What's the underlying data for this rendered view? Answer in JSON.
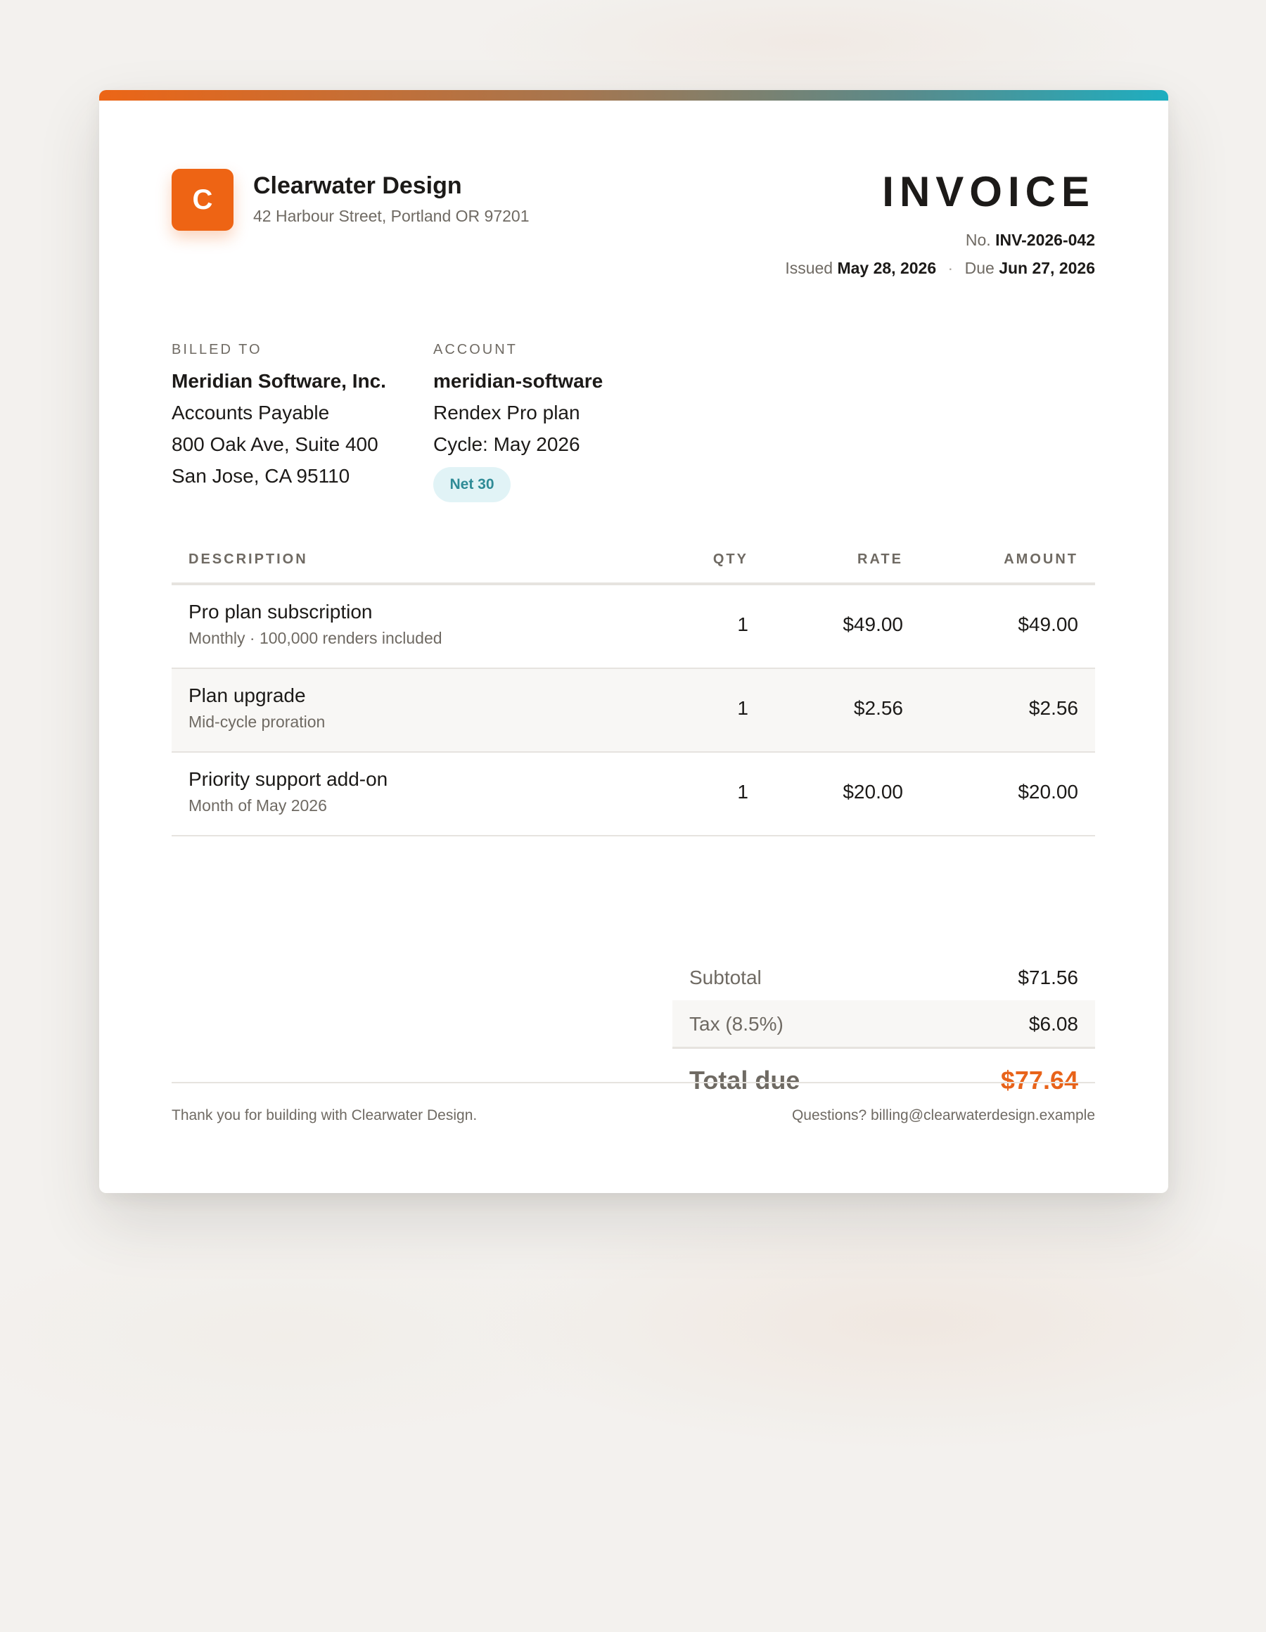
{
  "colors": {
    "brand": "#ee6414",
    "accent_teal": "#1eaec0",
    "total_due": "#e8631a",
    "badge_bg": "#e1f3f6",
    "badge_text": "#2f8b96"
  },
  "company": {
    "logo_letter": "C",
    "name": "Clearwater Design",
    "address": "42 Harbour Street, Portland OR 97201"
  },
  "invoice": {
    "title": "INVOICE",
    "number_label": "No.",
    "number": "INV-2026-042",
    "issued_label": "Issued",
    "issued_date": "May 28, 2026",
    "separator": "·",
    "due_label": "Due",
    "due_date": "Jun 27, 2026"
  },
  "billed_to": {
    "label": "BILLED TO",
    "name": "Meridian Software, Inc.",
    "department": "Accounts Payable",
    "street": "800 Oak Ave, Suite 400",
    "city": "San Jose, CA 95110"
  },
  "account": {
    "label": "ACCOUNT",
    "id": "meridian-software",
    "plan": "Rendex Pro plan",
    "cycle": "Cycle: May 2026",
    "terms_badge": "Net 30"
  },
  "table": {
    "headers": {
      "description": "DESCRIPTION",
      "qty": "QTY",
      "rate": "RATE",
      "amount": "AMOUNT"
    },
    "rows": [
      {
        "description": "Pro plan subscription",
        "detail": "Monthly · 100,000 renders included",
        "qty": "1",
        "rate": "$49.00",
        "amount": "$49.00"
      },
      {
        "description": "Plan upgrade",
        "detail": "Mid-cycle proration",
        "qty": "1",
        "rate": "$2.56",
        "amount": "$2.56"
      },
      {
        "description": "Priority support add-on",
        "detail": "Month of May 2026",
        "qty": "1",
        "rate": "$20.00",
        "amount": "$20.00"
      }
    ]
  },
  "totals": {
    "subtotal_label": "Subtotal",
    "subtotal": "$71.56",
    "tax_label": "Tax (8.5%)",
    "tax": "$6.08",
    "total_label": "Total due",
    "total": "$77.64"
  },
  "footer": {
    "thanks": "Thank you for building with Clearwater Design.",
    "contact": "Questions? billing@clearwaterdesign.example"
  }
}
